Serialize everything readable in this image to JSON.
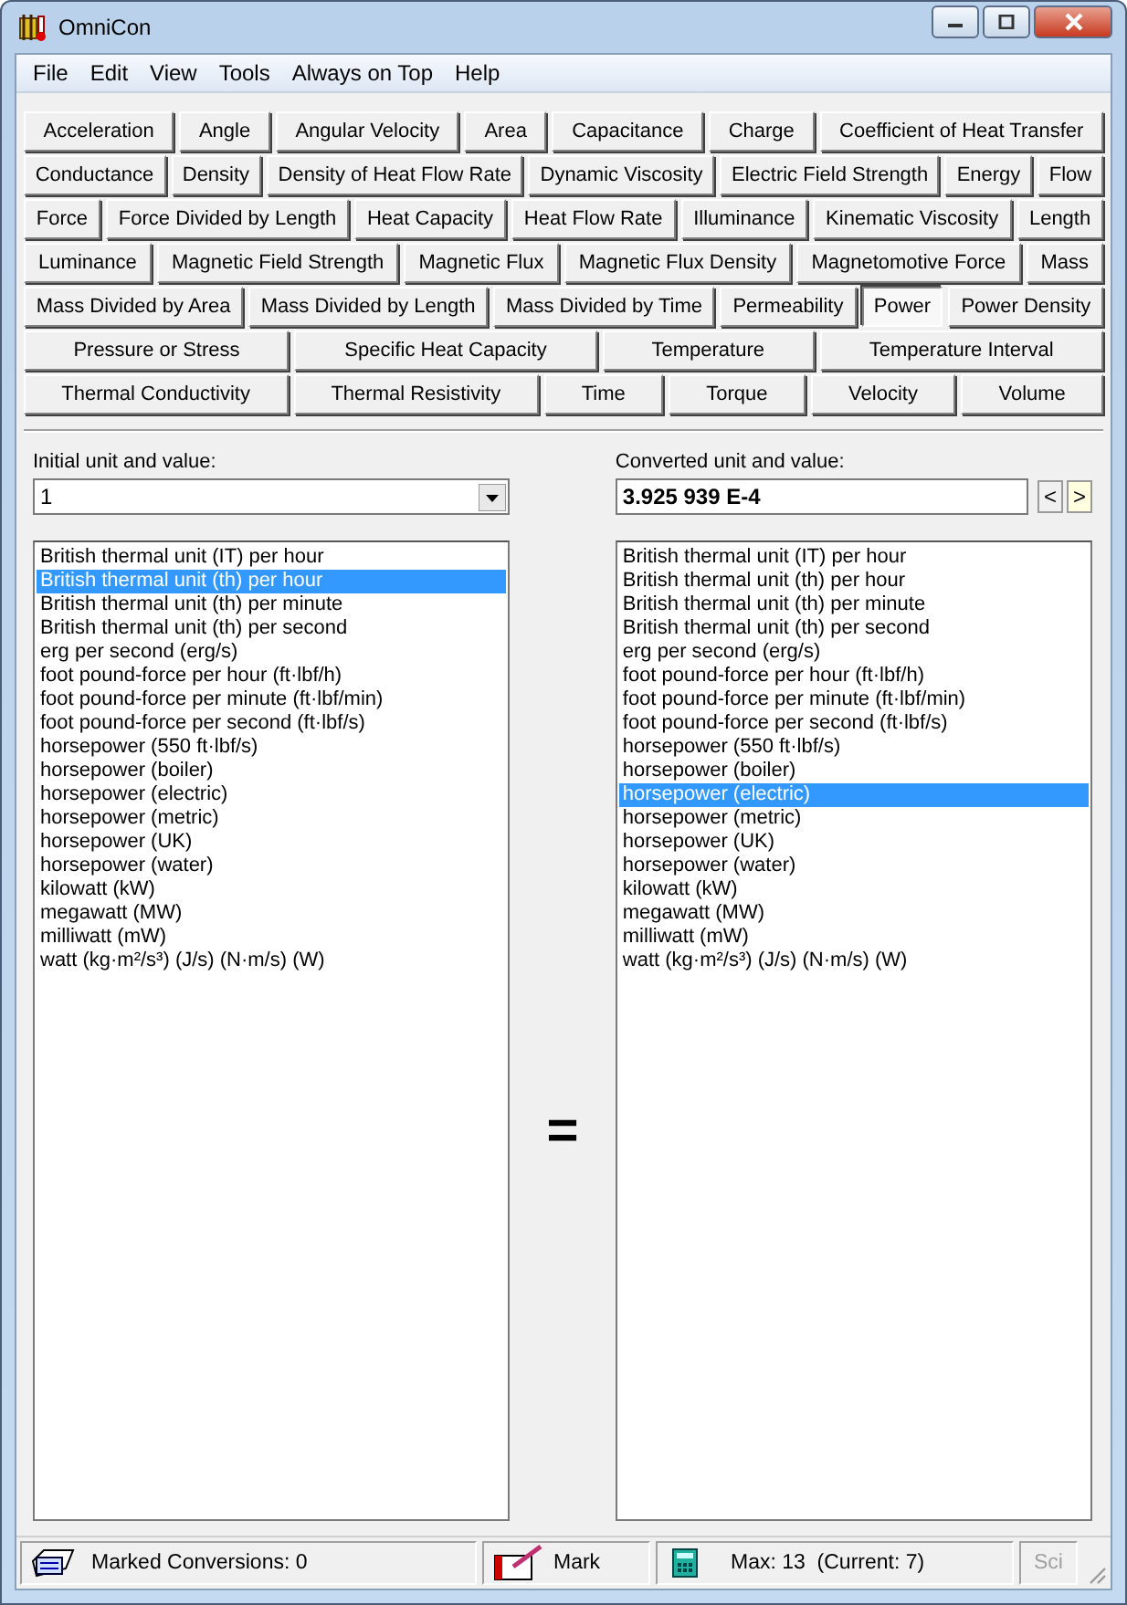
{
  "window": {
    "title": "OmniCon"
  },
  "menu": [
    "File",
    "Edit",
    "View",
    "Tools",
    "Always on Top",
    "Help"
  ],
  "quantity_rows": [
    [
      {
        "label": "Acceleration",
        "selected": false
      },
      {
        "label": "Angle",
        "selected": false
      },
      {
        "label": "Angular Velocity",
        "selected": false
      },
      {
        "label": "Area",
        "selected": false
      },
      {
        "label": "Capacitance",
        "selected": false
      },
      {
        "label": "Charge",
        "selected": false
      },
      {
        "label": "Coefficient of Heat Transfer",
        "selected": false
      }
    ],
    [
      {
        "label": "Conductance",
        "selected": false
      },
      {
        "label": "Density",
        "selected": false
      },
      {
        "label": "Density of Heat Flow Rate",
        "selected": false
      },
      {
        "label": "Dynamic Viscosity",
        "selected": false
      },
      {
        "label": "Electric Field Strength",
        "selected": false
      },
      {
        "label": "Energy",
        "selected": false
      },
      {
        "label": "Flow",
        "selected": false
      }
    ],
    [
      {
        "label": "Force",
        "selected": false
      },
      {
        "label": "Force Divided by Length",
        "selected": false
      },
      {
        "label": "Heat Capacity",
        "selected": false
      },
      {
        "label": "Heat Flow Rate",
        "selected": false
      },
      {
        "label": "Illuminance",
        "selected": false
      },
      {
        "label": "Kinematic Viscosity",
        "selected": false
      },
      {
        "label": "Length",
        "selected": false
      }
    ],
    [
      {
        "label": "Luminance",
        "selected": false
      },
      {
        "label": "Magnetic Field Strength",
        "selected": false
      },
      {
        "label": "Magnetic Flux",
        "selected": false
      },
      {
        "label": "Magnetic Flux Density",
        "selected": false
      },
      {
        "label": "Magnetomotive Force",
        "selected": false
      },
      {
        "label": "Mass",
        "selected": false
      }
    ],
    [
      {
        "label": "Mass Divided by Area",
        "selected": false
      },
      {
        "label": "Mass Divided by Length",
        "selected": false
      },
      {
        "label": "Mass Divided by Time",
        "selected": false
      },
      {
        "label": "Permeability",
        "selected": false
      },
      {
        "label": "Power",
        "selected": true
      },
      {
        "label": "Power Density",
        "selected": false
      }
    ],
    [
      {
        "label": "Pressure or Stress",
        "selected": false
      },
      {
        "label": "Specific Heat Capacity",
        "selected": false
      },
      {
        "label": "Temperature",
        "selected": false
      },
      {
        "label": "Temperature Interval",
        "selected": false
      }
    ],
    [
      {
        "label": "Thermal Conductivity",
        "selected": false
      },
      {
        "label": "Thermal Resistivity",
        "selected": false
      },
      {
        "label": "Time",
        "selected": false
      },
      {
        "label": "Torque",
        "selected": false
      },
      {
        "label": "Velocity",
        "selected": false
      },
      {
        "label": "Volume",
        "selected": false
      }
    ]
  ],
  "initial": {
    "label": "Initial unit and value:",
    "value": "1",
    "units": [
      {
        "label": "British thermal unit (IT) per hour",
        "selected": false
      },
      {
        "label": "British thermal unit (th) per hour",
        "selected": true
      },
      {
        "label": "British thermal unit (th) per minute",
        "selected": false
      },
      {
        "label": "British thermal unit (th) per second",
        "selected": false
      },
      {
        "label": "erg per second (erg/s)",
        "selected": false
      },
      {
        "label": "foot pound-force per hour (ft·lbf/h)",
        "selected": false
      },
      {
        "label": "foot pound-force per minute (ft·lbf/min)",
        "selected": false
      },
      {
        "label": "foot pound-force per second (ft·lbf/s)",
        "selected": false
      },
      {
        "label": "horsepower (550 ft·lbf/s)",
        "selected": false
      },
      {
        "label": "horsepower (boiler)",
        "selected": false
      },
      {
        "label": "horsepower (electric)",
        "selected": false
      },
      {
        "label": "horsepower (metric)",
        "selected": false
      },
      {
        "label": "horsepower (UK)",
        "selected": false
      },
      {
        "label": "horsepower (water)",
        "selected": false
      },
      {
        "label": "kilowatt (kW)",
        "selected": false
      },
      {
        "label": "megawatt (MW)",
        "selected": false
      },
      {
        "label": "milliwatt (mW)",
        "selected": false
      },
      {
        "label": "watt (kg·m²/s³) (J/s) (N·m/s) (W)",
        "selected": false
      }
    ]
  },
  "equals": "=",
  "converted": {
    "label": "Converted unit and value:",
    "value": "3.925 939 E-4",
    "prev": "<",
    "next": ">",
    "units": [
      {
        "label": "British thermal unit (IT) per hour",
        "selected": false
      },
      {
        "label": "British thermal unit (th) per hour",
        "selected": false
      },
      {
        "label": "British thermal unit (th) per minute",
        "selected": false
      },
      {
        "label": "British thermal unit (th) per second",
        "selected": false
      },
      {
        "label": "erg per second (erg/s)",
        "selected": false
      },
      {
        "label": "foot pound-force per hour (ft·lbf/h)",
        "selected": false
      },
      {
        "label": "foot pound-force per minute (ft·lbf/min)",
        "selected": false
      },
      {
        "label": "foot pound-force per second (ft·lbf/s)",
        "selected": false
      },
      {
        "label": "horsepower (550 ft·lbf/s)",
        "selected": false
      },
      {
        "label": "horsepower (boiler)",
        "selected": false
      },
      {
        "label": "horsepower (electric)",
        "selected": true
      },
      {
        "label": "horsepower (metric)",
        "selected": false
      },
      {
        "label": "horsepower (UK)",
        "selected": false
      },
      {
        "label": "horsepower (water)",
        "selected": false
      },
      {
        "label": "kilowatt (kW)",
        "selected": false
      },
      {
        "label": "megawatt (MW)",
        "selected": false
      },
      {
        "label": "milliwatt (mW)",
        "selected": false
      },
      {
        "label": "watt (kg·m²/s³) (J/s) (N·m/s) (W)",
        "selected": false
      }
    ]
  },
  "status_bar": {
    "marked": "Marked Conversions: 0",
    "mark": "Mark",
    "precision": "Max: 13  (Current: 7)",
    "sci": {
      "label": "Sci",
      "disabled": true
    }
  }
}
